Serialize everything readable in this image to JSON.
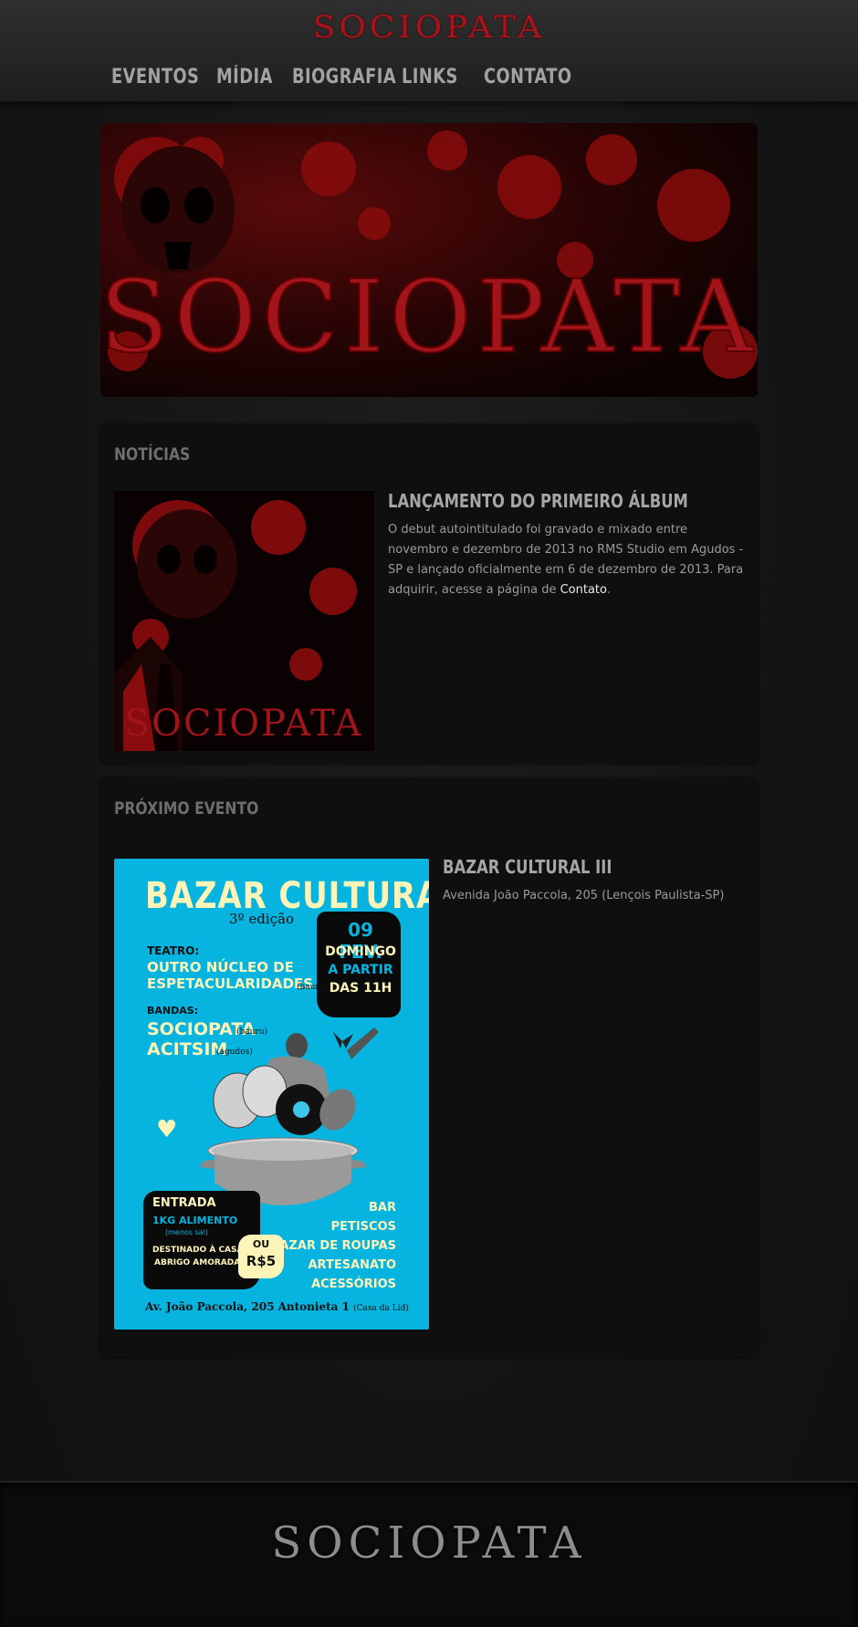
{
  "site": {
    "logo": "SOCIOPATA",
    "footer_logo": "SOCIOPATA"
  },
  "nav": {
    "items": [
      {
        "label": "Eventos"
      },
      {
        "label": "Mídia"
      },
      {
        "label": "Biografia"
      },
      {
        "label": "Links"
      },
      {
        "label": "Contato"
      }
    ]
  },
  "banner": {
    "text": "SOCIOPATA"
  },
  "news": {
    "title": "Notícias",
    "item": {
      "image_text": "SOCIOPATA",
      "title": "Lançamento do primeiro álbum",
      "text_before": "O debut autointitulado foi gravado e mixado entre novembro e dezembro de 2013 no RMS Studio em Agudos - SP e lançado oficialmente em 6 de dezembro de 2013. Para adquirir, acesse a página de ",
      "link": "Contato",
      "text_after": "."
    }
  },
  "event": {
    "title": "Próximo Evento",
    "name": "BAZAR CULTURAL III",
    "address": "Avenida João Paccola, 205 (Lençois Paulista-SP)",
    "poster": {
      "title": "BAZAR CULTURAL",
      "edition": "3º edição",
      "date": "09 FEV.",
      "day": "DOMINGO",
      "time1": "A PARTIR",
      "time2": "DAS 11H",
      "teatro_label": "TEATRO:",
      "teatro1": "OUTRO NÚCLEO DE",
      "teatro2": "ESPETACULARIDADES",
      "teatro_city": "(bauru)",
      "bandas_label": "BANDAS:",
      "band1": "SOCIOPATA",
      "band1_city": "(bauru)",
      "band2": "ACITSIM",
      "band2_city": "(agudos)",
      "entrada": "ENTRADA",
      "alimento": "1KG ALIMENTO",
      "menos_sal": "(menos sal)",
      "destinado1": "DESTINADO À CASA",
      "destinado2": "ABRIGO AMORADA",
      "ou": "OU",
      "preco": "R$5",
      "extras": [
        "BAR",
        "PETISCOS",
        "BAZAR DE ROUPAS",
        "ARTESANATO",
        "ACESSÓRIOS"
      ],
      "address": "Av. João Paccola, 205 Antonieta 1",
      "address_note": "(Casa da Lid)"
    }
  },
  "colors": {
    "accent_red": "#a8141c",
    "poster_blue": "#06b4df",
    "poster_yellow": "#fff4b8"
  }
}
